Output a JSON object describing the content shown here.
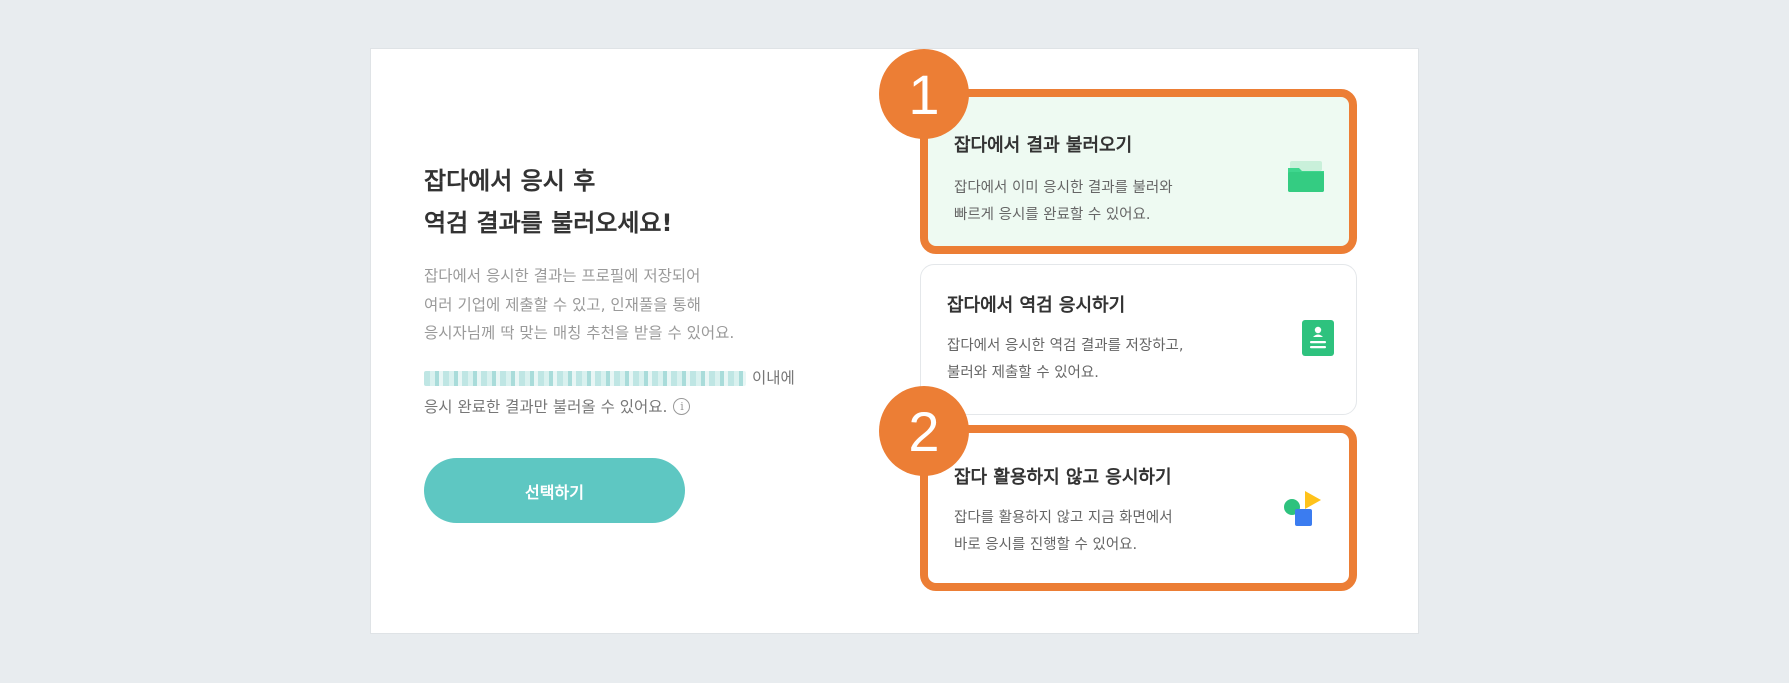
{
  "left": {
    "heading_line1": "잡다에서 응시 후",
    "heading_line2": "역검 결과를 불러오세요!",
    "desc_line1": "잡다에서 응시한 결과는 프로필에 저장되어",
    "desc_line2": "여러 기업에 제출할 수 있고, 인재풀을 통해",
    "desc_line3": "응시자님께 딱 맞는 매칭 추천을 받을 수 있어요.",
    "notice_suffix": "이내에",
    "notice_line2": "응시 완료한 결과만 불러올 수 있어요.",
    "info_icon_glyph": "i",
    "select_button": "선택하기"
  },
  "cards": [
    {
      "title": "잡다에서 결과 불러오기",
      "desc_line1": "잡다에서 이미 응시한 결과를 불러와",
      "desc_line2": "빠르게 응시를 완료할 수 있어요.",
      "icon": "folder-icon"
    },
    {
      "title": "잡다에서 역검 응시하기",
      "desc_line1": "잡다에서 응시한 역검 결과를 저장하고,",
      "desc_line2": "불러와 제출할 수 있어요.",
      "icon": "profile-document-icon"
    },
    {
      "title": "잡다 활용하지 않고 응시하기",
      "desc_line1": "잡다를 활용하지 않고 지금 화면에서",
      "desc_line2": "바로 응시를 진행할 수 있어요.",
      "icon": "shapes-icon"
    }
  ],
  "badges": {
    "first": "1",
    "second": "2"
  },
  "colors": {
    "accent_orange": "#ec7e35",
    "button_teal": "#5ec7c2",
    "icon_green": "#2ec27e"
  }
}
